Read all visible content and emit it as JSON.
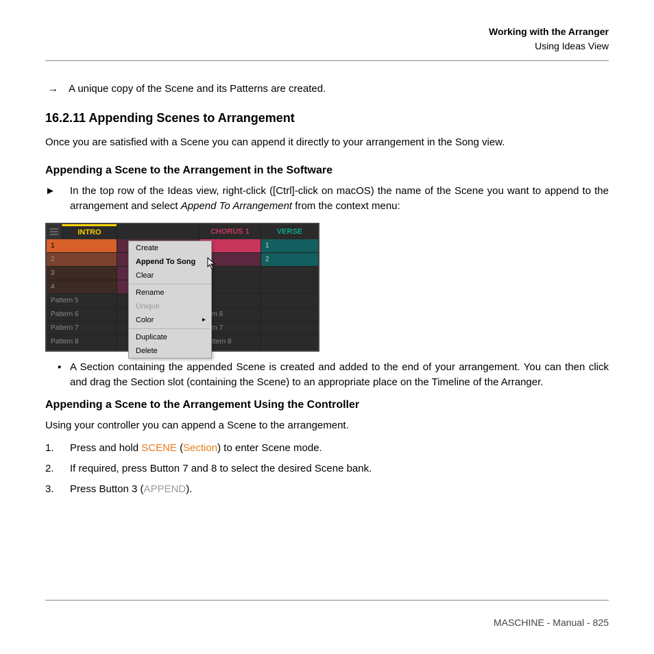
{
  "running_head": {
    "bold": "Working with the Arranger",
    "sub": "Using Ideas View"
  },
  "arrow_text": "A unique copy of the Scene and its Patterns are created.",
  "heading": "16.2.11   Appending Scenes to Arrangement",
  "para1": "Once you are satisfied with a Scene you can append it directly to your arrangement in the Song view.",
  "subhead1": "Appending a Scene to the Arrangement in the Software",
  "step_bullet1_a": "In the top row of the Ideas view, right-click ([Ctrl]-click on macOS) the name of the Scene you want to append to the arrangement and select ",
  "step_bullet1_italic": "Append To Arrangement",
  "step_bullet1_b": " from the context menu:",
  "step_bullet2": "A Section containing the appended Scene is created and added to the end of your arrangement. You can then click and drag the Section slot (containing the Scene) to an appropriate place on the Timeline of the Arranger.",
  "subhead2": "Appending a Scene to the Arrangement Using the Controller",
  "para2": "Using your controller you can append a Scene to the arrangement.",
  "ol": [
    {
      "num": "1.",
      "pre": "Press and hold ",
      "orange1": "SCENE",
      "paren_open": " (",
      "orange2": "Section",
      "post": ") to enter Scene mode."
    },
    {
      "num": "2.",
      "text": "If required, press Button 7 and 8 to select the desired Scene bank."
    },
    {
      "num": "3.",
      "pre": "Press Button 3 (",
      "gray": "APPEND",
      "post": ")."
    }
  ],
  "figure": {
    "headers": [
      "INTRO",
      "",
      "CHORUS 1",
      "VERSE"
    ],
    "col1": [
      "1",
      "2",
      "3",
      "4",
      "Pattern 5",
      "Pattern 6",
      "Pattern 7",
      "Pattern 8"
    ],
    "col2": [
      "",
      "",
      "",
      "",
      "",
      "",
      "",
      ""
    ],
    "col3_patterns": [
      "ttern 6",
      "ttern 7",
      "Pattern 8"
    ],
    "col4": [
      "1",
      "2"
    ],
    "menu": [
      "Create",
      "Append To Song",
      "Clear",
      "Rename",
      "Unique",
      "Color",
      "Duplicate",
      "Delete"
    ]
  },
  "footer": "MASCHINE - Manual - 825"
}
